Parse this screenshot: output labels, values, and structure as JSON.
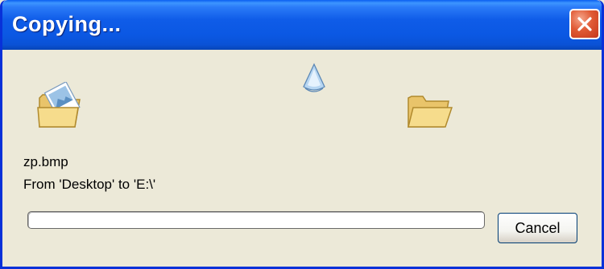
{
  "window": {
    "title": "Copying..."
  },
  "titlebar": {
    "close_icon": "close-icon"
  },
  "animation": {
    "source_icon": "source-folder-icon",
    "document_icon": "flying-document-icon",
    "destination_icon": "destination-folder-icon"
  },
  "file": {
    "name": "zp.bmp",
    "from_to": "From 'Desktop' to 'E:\\'"
  },
  "progress": {
    "percent": 0
  },
  "buttons": {
    "cancel_label": "Cancel"
  },
  "colors": {
    "titlebar": "#0a52d6",
    "dialog_background": "#ece9d8",
    "close_button": "#e05a35",
    "progress_fill": "#2ab42a"
  }
}
